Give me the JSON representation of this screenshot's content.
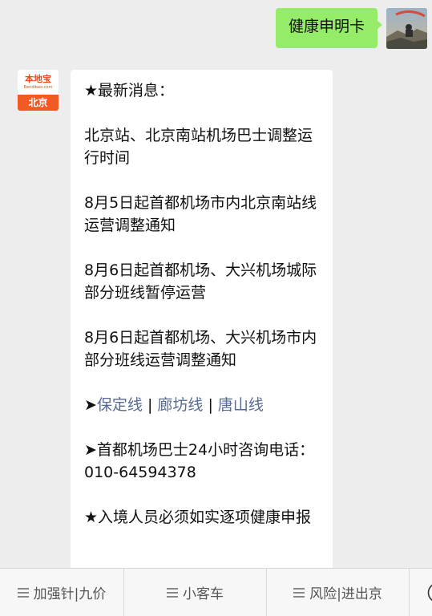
{
  "outgoing_message": {
    "text": "健康申明卡"
  },
  "bot_avatar": {
    "brand_text": "本地宝",
    "url_text": "Bendibao.com",
    "city_text": "北京"
  },
  "incoming_message": {
    "header": "★最新消息：",
    "items": [
      "北京站、北京南站机场巴士调整运行时间",
      "8月5日起首都机场市内北京南站线运营调整通知",
      "8月6日起首都机场、大兴机场城际部分班线暂停运营",
      "8月6日起首都机场、大兴机场市内部分班线运营调整通知"
    ],
    "routes": {
      "arrow": "➤",
      "links": [
        "保定线",
        "廊坊线",
        "唐山线"
      ],
      "separator": " | "
    },
    "hotline": {
      "text": "➤首都机场巴士24小时咨询电话：010-64594378"
    },
    "notice": {
      "text": "★入境人员必须如实逐项健康申报"
    }
  },
  "menu_bar": {
    "items": [
      {
        "label": "加强针|九价"
      },
      {
        "label": "小客车"
      },
      {
        "label": "风险|进出京"
      }
    ]
  },
  "icons": {
    "menu_item_icon": "hamburger-icon",
    "keyboard_icon": "keyboard-icon"
  }
}
